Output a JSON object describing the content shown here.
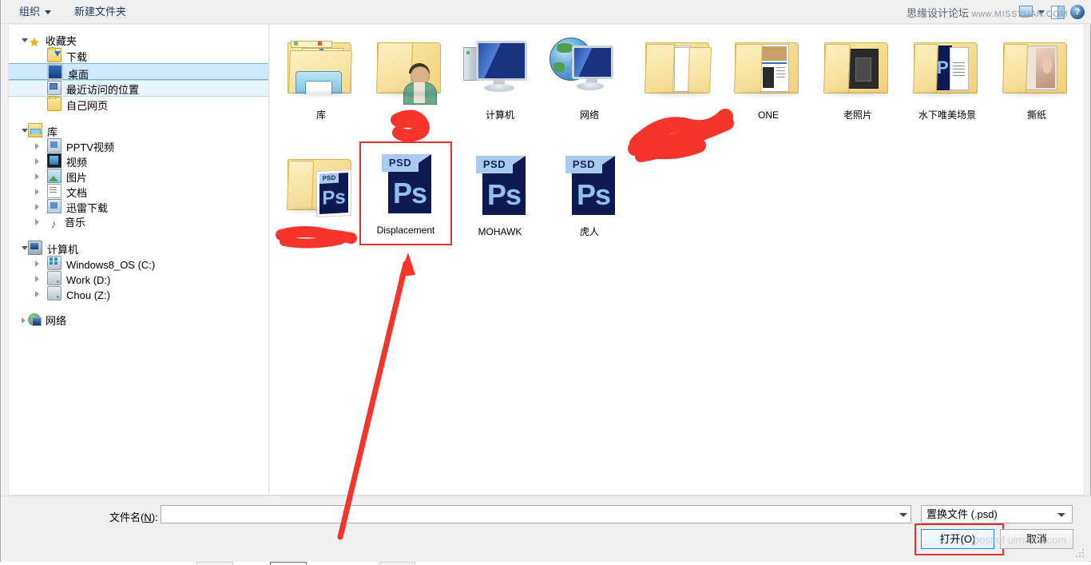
{
  "window": {
    "type": "file-open-dialog",
    "os_style": "Windows 7/8 Explorer"
  },
  "toolbar": {
    "organize_label": "组织",
    "new_folder_label": "新建文件夹",
    "view_icon": "view-layout-icon",
    "pane_icon": "preview-pane-icon",
    "help_icon": "help-icon",
    "help_glyph": "?",
    "watermark_cn": "思缘设计论坛",
    "watermark_en": "www.MISSYUAN.COM"
  },
  "sidebar": {
    "groups": [
      {
        "name": "favorites",
        "header": {
          "label": "收藏夹",
          "icon": "star-icon",
          "expanded": true
        },
        "items": [
          {
            "label": "下载",
            "icon": "downloads-folder-icon",
            "state": "normal",
            "expandable": false
          },
          {
            "label": "桌面",
            "icon": "desktop-icon",
            "state": "selected",
            "expandable": false
          },
          {
            "label": "最近访问的位置",
            "icon": "recent-places-icon",
            "state": "hover",
            "expandable": false
          },
          {
            "label": "自己网页",
            "icon": "folder-icon",
            "state": "normal",
            "expandable": false
          }
        ]
      },
      {
        "name": "libraries",
        "header": {
          "label": "库",
          "icon": "library-icon",
          "expanded": true
        },
        "items": [
          {
            "label": "PPTV视频",
            "icon": "library-pptv-icon",
            "state": "normal",
            "expandable": true
          },
          {
            "label": "视频",
            "icon": "library-video-icon",
            "state": "normal",
            "expandable": true
          },
          {
            "label": "图片",
            "icon": "library-pictures-icon",
            "state": "normal",
            "expandable": true
          },
          {
            "label": "文档",
            "icon": "library-documents-icon",
            "state": "normal",
            "expandable": true
          },
          {
            "label": "迅雷下载",
            "icon": "library-thunder-icon",
            "state": "normal",
            "expandable": true
          },
          {
            "label": "音乐",
            "icon": "library-music-icon",
            "state": "normal",
            "expandable": true
          }
        ]
      },
      {
        "name": "computer",
        "header": {
          "label": "计算机",
          "icon": "computer-icon",
          "expanded": true
        },
        "items": [
          {
            "label": "Windows8_OS (C:)",
            "icon": "os-drive-icon",
            "state": "normal",
            "expandable": true
          },
          {
            "label": "Work (D:)",
            "icon": "hard-drive-icon",
            "state": "normal",
            "expandable": true
          },
          {
            "label": "Chou (Z:)",
            "icon": "hard-drive-icon",
            "state": "normal",
            "expandable": true
          }
        ]
      },
      {
        "name": "network",
        "header": {
          "label": "网络",
          "icon": "network-icon",
          "expanded": false
        },
        "items": []
      }
    ]
  },
  "files": {
    "items": [
      {
        "label": "库",
        "icon": "libraries-folder-icon",
        "kind": "special",
        "selected": false,
        "obscured": false
      },
      {
        "label": "",
        "icon": "user-folder-icon",
        "kind": "special",
        "selected": false,
        "obscured": true
      },
      {
        "label": "计算机",
        "icon": "computer-icon",
        "kind": "special",
        "selected": false,
        "obscured": false
      },
      {
        "label": "网络",
        "icon": "network-icon",
        "kind": "special",
        "selected": false,
        "obscured": false
      },
      {
        "label": "",
        "icon": "folder-with-files-icon",
        "kind": "folder",
        "selected": false,
        "obscured": true
      },
      {
        "label": "ONE",
        "icon": "folder-with-preview-icon",
        "kind": "folder",
        "selected": false,
        "obscured": false
      },
      {
        "label": "老照片",
        "icon": "folder-with-preview-icon",
        "kind": "folder",
        "selected": false,
        "obscured": false
      },
      {
        "label": "水下唯美场景",
        "icon": "folder-with-preview-icon",
        "kind": "folder",
        "selected": false,
        "obscured": false
      },
      {
        "label": "撕纸",
        "icon": "folder-with-preview-icon",
        "kind": "folder",
        "selected": false,
        "obscured": false
      },
      {
        "label": "",
        "icon": "folder-with-psd-icon",
        "kind": "folder",
        "selected": false,
        "obscured": true
      },
      {
        "label": "Displacement",
        "icon": "psd-file-icon",
        "kind": "psd",
        "selected": true,
        "obscured": false
      },
      {
        "label": "MOHAWK",
        "icon": "psd-file-icon",
        "kind": "psd",
        "selected": false,
        "obscured": false
      },
      {
        "label": "虎人",
        "icon": "psd-file-icon",
        "kind": "psd",
        "selected": false,
        "obscured": false
      }
    ],
    "psd_badge": "PSD",
    "psd_glyph": "Ps"
  },
  "footer": {
    "filename_label_prefix": "文件名(",
    "filename_label_key": "N",
    "filename_label_suffix": "):",
    "filename_value": "",
    "filename_placeholder": "",
    "filter_value": "置换文件 (.psd)",
    "open_button": "打开(O)",
    "cancel_button": "取消",
    "watermark": "post of uimaker.com"
  },
  "annotations": {
    "accent_red": "#e8342a",
    "selection_outline_color": "#e03030",
    "open_button_outline_color": "#e03030",
    "arrow_target": "Displacement",
    "scribbles": 3
  }
}
